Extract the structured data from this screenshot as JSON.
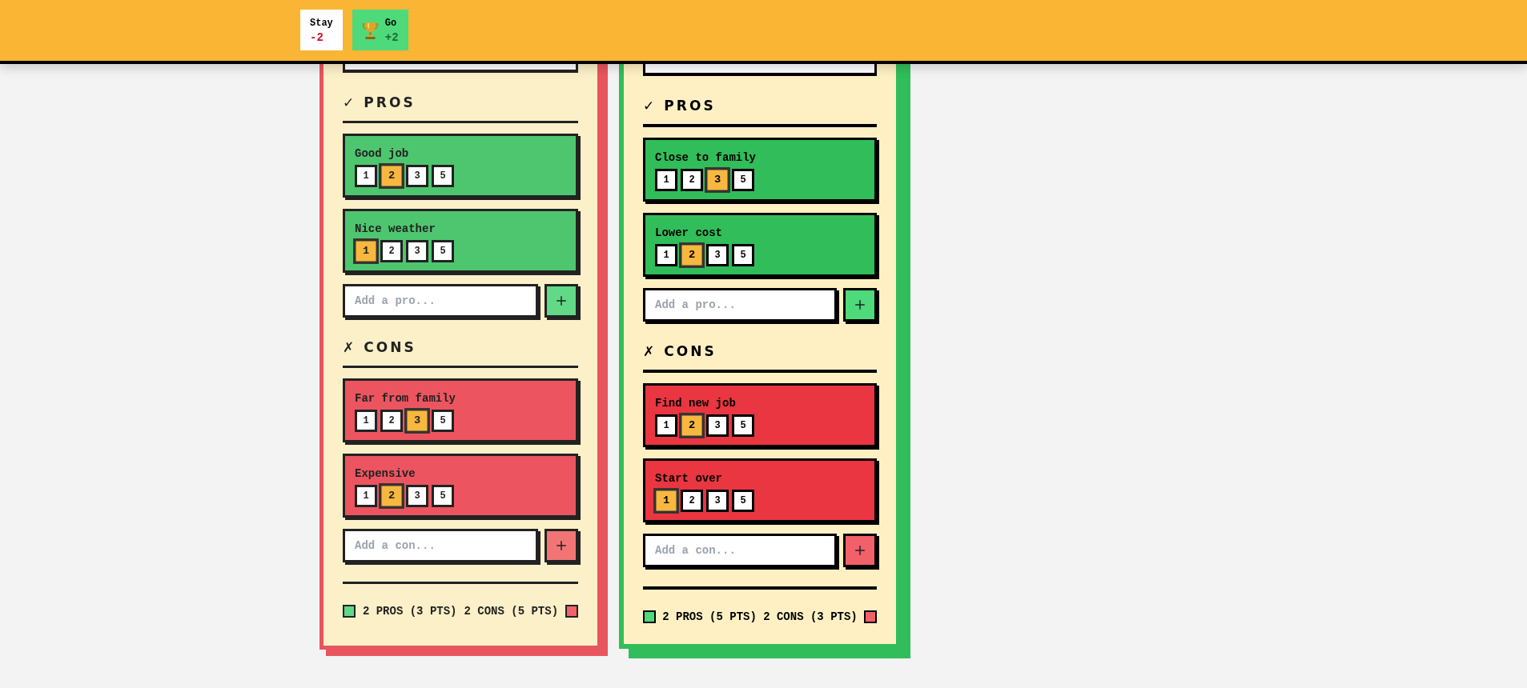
{
  "header": {
    "options": [
      {
        "name": "Stay",
        "score": "-2",
        "winner": false
      },
      {
        "name": "Go",
        "score": "+2",
        "winner": true
      }
    ]
  },
  "cards": [
    {
      "winner": false,
      "sections": [
        {
          "kind": "pros",
          "title": "✓ PROS",
          "items": [
            {
              "label": "Good job",
              "ratings": [
                {
                  "value": "1",
                  "selected": false
                },
                {
                  "value": "2",
                  "selected": true
                },
                {
                  "value": "3",
                  "selected": false
                },
                {
                  "value": "5",
                  "selected": false
                }
              ]
            },
            {
              "label": "Nice weather",
              "ratings": [
                {
                  "value": "1",
                  "selected": true
                },
                {
                  "value": "2",
                  "selected": false
                },
                {
                  "value": "3",
                  "selected": false
                },
                {
                  "value": "5",
                  "selected": false
                }
              ]
            }
          ],
          "placeholder": "Add a pro..."
        },
        {
          "kind": "cons",
          "title": "✗ CONS",
          "items": [
            {
              "label": "Far from family",
              "ratings": [
                {
                  "value": "1",
                  "selected": false
                },
                {
                  "value": "2",
                  "selected": false
                },
                {
                  "value": "3",
                  "selected": true
                },
                {
                  "value": "5",
                  "selected": false
                }
              ]
            },
            {
              "label": "Expensive",
              "ratings": [
                {
                  "value": "1",
                  "selected": false
                },
                {
                  "value": "2",
                  "selected": true
                },
                {
                  "value": "3",
                  "selected": false
                },
                {
                  "value": "5",
                  "selected": false
                }
              ]
            }
          ],
          "placeholder": "Add a con..."
        }
      ],
      "summary": {
        "pros": "2 PROS (3 PTS)",
        "cons": "2 CONS (5 PTS)"
      }
    },
    {
      "winner": true,
      "sections": [
        {
          "kind": "pros",
          "title": "✓ PROS",
          "items": [
            {
              "label": "Close to family",
              "ratings": [
                {
                  "value": "1",
                  "selected": false
                },
                {
                  "value": "2",
                  "selected": false
                },
                {
                  "value": "3",
                  "selected": true
                },
                {
                  "value": "5",
                  "selected": false
                }
              ]
            },
            {
              "label": "Lower cost",
              "ratings": [
                {
                  "value": "1",
                  "selected": false
                },
                {
                  "value": "2",
                  "selected": true
                },
                {
                  "value": "3",
                  "selected": false
                },
                {
                  "value": "5",
                  "selected": false
                }
              ]
            }
          ],
          "placeholder": "Add a pro..."
        },
        {
          "kind": "cons",
          "title": "✗ CONS",
          "items": [
            {
              "label": "Find new job",
              "ratings": [
                {
                  "value": "1",
                  "selected": false
                },
                {
                  "value": "2",
                  "selected": true
                },
                {
                  "value": "3",
                  "selected": false
                },
                {
                  "value": "5",
                  "selected": false
                }
              ]
            },
            {
              "label": "Start over",
              "ratings": [
                {
                  "value": "1",
                  "selected": true
                },
                {
                  "value": "2",
                  "selected": false
                },
                {
                  "value": "3",
                  "selected": false
                },
                {
                  "value": "5",
                  "selected": false
                }
              ]
            }
          ],
          "placeholder": "Add a con..."
        }
      ],
      "summary": {
        "pros": "2 PROS (5 PTS)",
        "cons": "2 CONS (3 PTS)"
      }
    }
  ]
}
